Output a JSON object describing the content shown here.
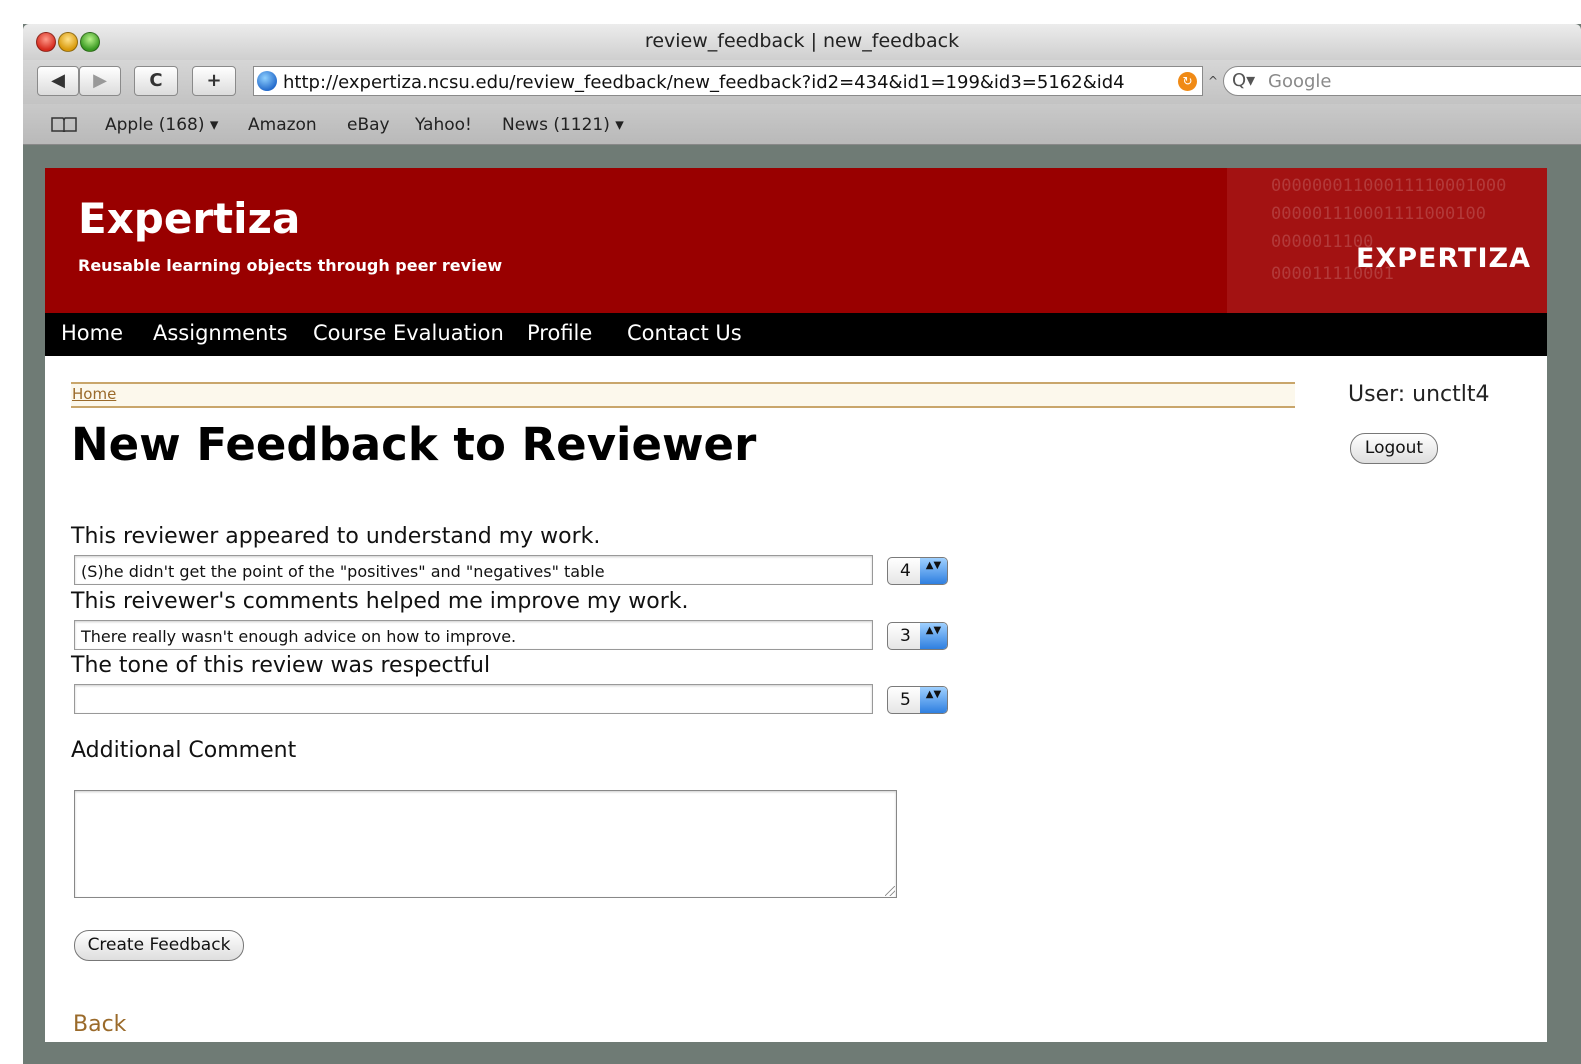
{
  "browser": {
    "title": "review_feedback | new_feedback",
    "url": "http://expertiza.ncsu.edu/review_feedback/new_feedback?id2=434&id1=199&id3=5162&id4",
    "search_placeholder": "Google",
    "back_glyph": "◀",
    "forward_glyph": "▶",
    "reload_glyph": "C",
    "add_glyph": "+",
    "rss_glyph": "↻",
    "snapback_glyph": "^",
    "search_glyph": "Q▾",
    "bookmarks": [
      "Apple (168) ▾",
      "Amazon",
      "eBay",
      "Yahoo!",
      "News (1121) ▾"
    ]
  },
  "header": {
    "logo": "Expertiza",
    "tagline": "Reusable learning objects through peer review",
    "brand": "EXPERTIZA",
    "binary_lines": [
      "00000001100011110001000",
      "000001110001111000100",
      "0000011100",
      "000011110001"
    ]
  },
  "nav": [
    "Home",
    "Assignments",
    "Course Evaluation",
    "Profile",
    "Contact Us"
  ],
  "breadcrumb": "Home",
  "page_title": "New Feedback to Reviewer",
  "user_label": "User: unctlt4",
  "logout_label": "Logout",
  "questions": [
    {
      "text": "This reviewer appeared to understand my work.",
      "comment": "(S)he didn't get the point of the \"positives\" and \"negatives\" table",
      "score": "4"
    },
    {
      "text": "This reivewer's comments helped me improve my work.",
      "comment": "There really wasn't enough advice on how to improve.",
      "score": "3"
    },
    {
      "text": "The tone of this review was respectful",
      "comment": "",
      "score": "5"
    }
  ],
  "additional_comment_label": "Additional Comment",
  "additional_comment_value": "",
  "create_button": "Create Feedback",
  "back_link": "Back",
  "colors": {
    "header_bg": "#990000",
    "nav_bg": "#000000",
    "link": "#9a6a2a",
    "frame_bg": "#6f7b75"
  },
  "select_arrow_glyph": "▲▼",
  "icons": [
    "globe-icon",
    "rss-icon",
    "search-icon",
    "bookmarks-book-icon",
    "resize-grip-icon"
  ]
}
